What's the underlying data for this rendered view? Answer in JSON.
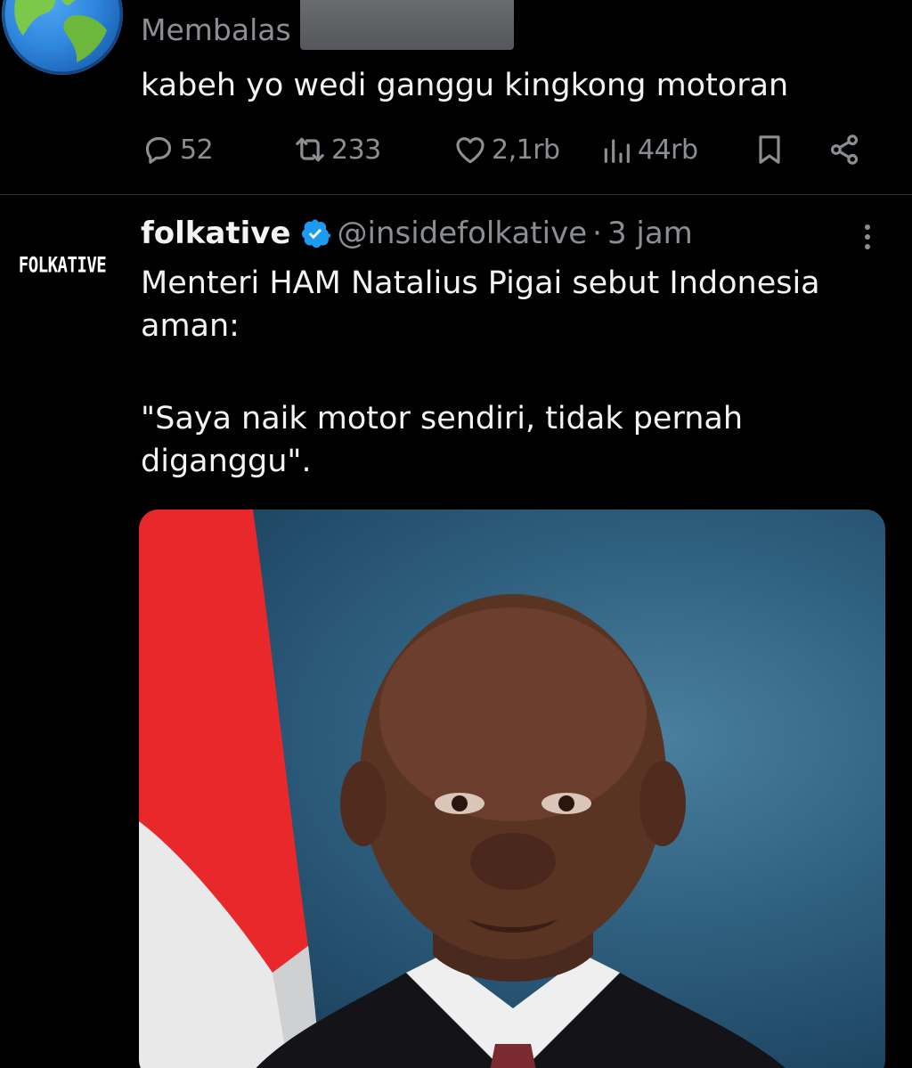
{
  "reply": {
    "avatar_icon": "earth-globe-icon",
    "replying_label": "Membalas",
    "text": "kabeh yo wedi ganggu kingkong motoran",
    "actions": {
      "reply_count": "52",
      "repost_count": "233",
      "like_count": "2,1rb",
      "view_count": "44rb"
    }
  },
  "tweet": {
    "avatar_logo": "FOLKATIVE",
    "display_name": "folkative",
    "handle": "@insidefolkative",
    "separator": "·",
    "time": "3 jam",
    "verified_color": "#1d9bf0",
    "lines": [
      "Menteri HAM Natalius Pigai sebut Indonesia aman:",
      "\"Saya naik motor sendiri, tidak pernah diganggu\"."
    ],
    "media_icon": "portrait-photo-icon"
  },
  "colors": {
    "background": "#000000",
    "text": "#e7e9ea",
    "muted": "#8b8f94",
    "divider": "#2f3336",
    "accent": "#1d9bf0"
  }
}
